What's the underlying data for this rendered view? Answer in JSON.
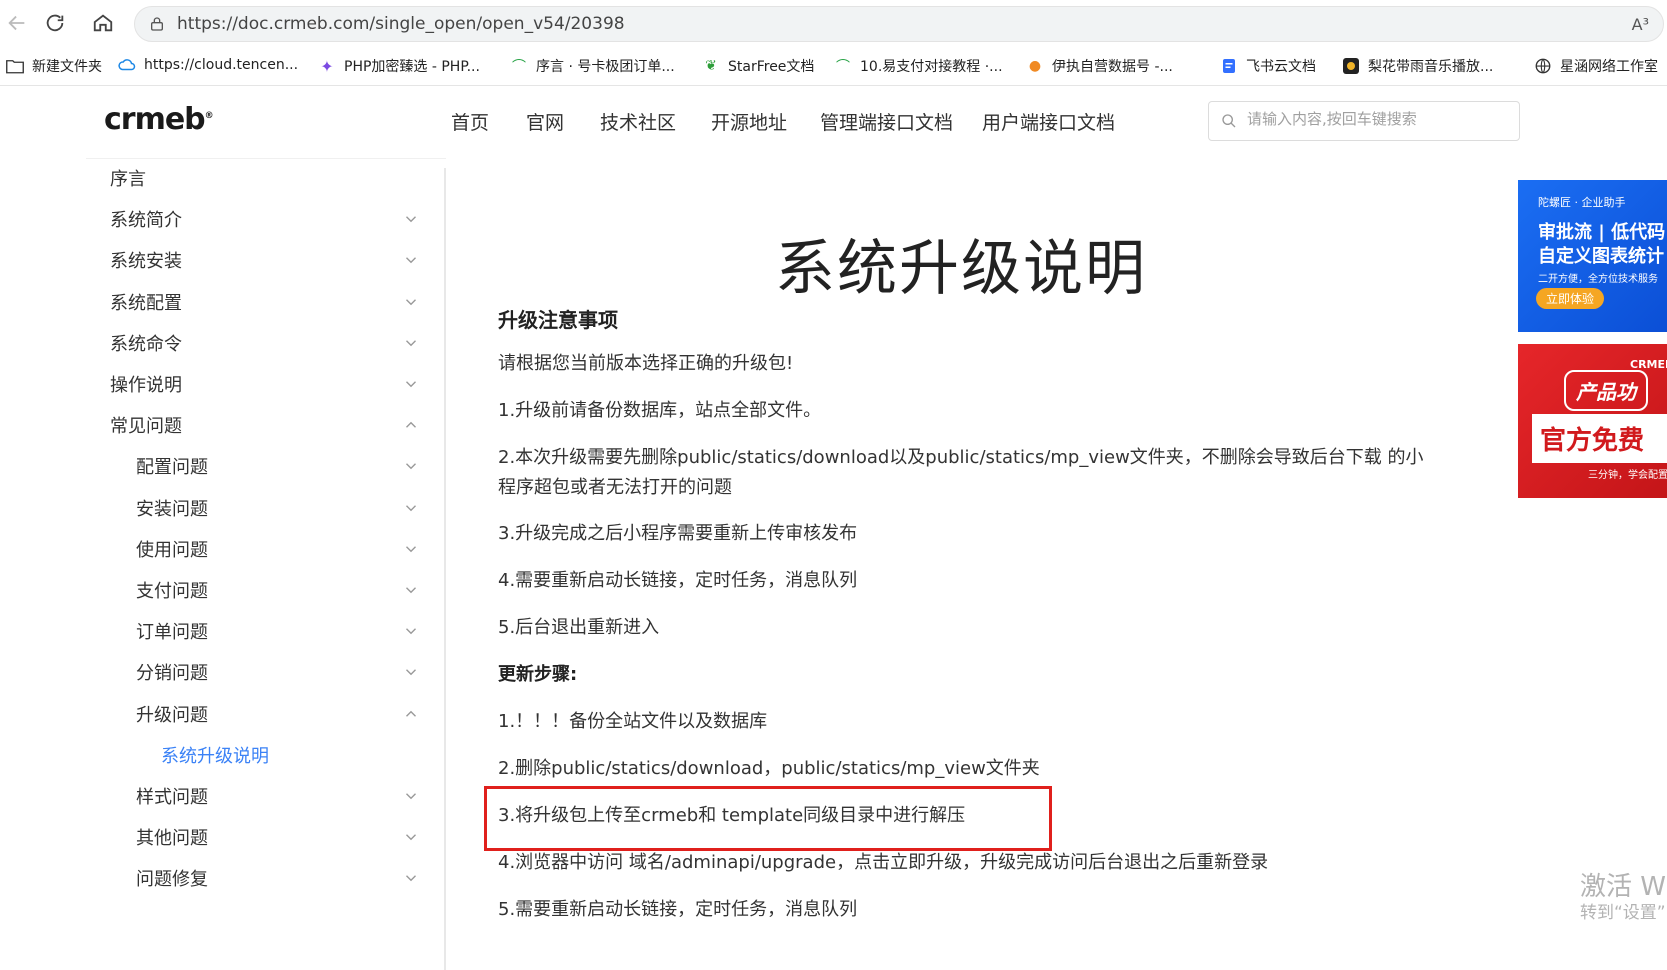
{
  "browser": {
    "url": "https://doc.crmeb.com/single_open/open_v54/20398",
    "read_aloud": "A³",
    "bookmarks": [
      {
        "label": "新建文件夹",
        "icon": "folder-icon"
      },
      {
        "label": "https://cloud.tencen...",
        "icon": "cloud-icon"
      },
      {
        "label": "PHP加密臻选 - PHP...",
        "icon": "star-icon"
      },
      {
        "label": "序言 · 号卡极团订单...",
        "icon": "link-icon"
      },
      {
        "label": "StarFree文档",
        "icon": "leaf-icon"
      },
      {
        "label": "10.易支付对接教程 ·...",
        "icon": "link-icon"
      },
      {
        "label": "伊执自营数据号 -...",
        "icon": "flame-icon"
      },
      {
        "label": "飞书云文档",
        "icon": "doc-icon"
      },
      {
        "label": "梨花带雨音乐播放...",
        "icon": "music-icon"
      },
      {
        "label": "星涵网络工作室",
        "icon": "globe-icon"
      }
    ]
  },
  "site": {
    "logo": "crmeb",
    "logo_mark": "®",
    "nav": [
      "首页",
      "官网",
      "技术社区",
      "开源地址",
      "管理端接口文档",
      "用户端接口文档"
    ],
    "search_placeholder": "请输入内容,按回车键搜索"
  },
  "sidebar": {
    "items": [
      {
        "label": "序言",
        "level": 0,
        "chevron": "none"
      },
      {
        "label": "系统简介",
        "level": 0,
        "chevron": "down"
      },
      {
        "label": "系统安装",
        "level": 0,
        "chevron": "down"
      },
      {
        "label": "系统配置",
        "level": 0,
        "chevron": "down"
      },
      {
        "label": "系统命令",
        "level": 0,
        "chevron": "down"
      },
      {
        "label": "操作说明",
        "level": 0,
        "chevron": "down"
      },
      {
        "label": "常见问题",
        "level": 0,
        "chevron": "up"
      },
      {
        "label": "配置问题",
        "level": 1,
        "chevron": "down"
      },
      {
        "label": "安装问题",
        "level": 1,
        "chevron": "down"
      },
      {
        "label": "使用问题",
        "level": 1,
        "chevron": "down"
      },
      {
        "label": "支付问题",
        "level": 1,
        "chevron": "down"
      },
      {
        "label": "订单问题",
        "level": 1,
        "chevron": "down"
      },
      {
        "label": "分销问题",
        "level": 1,
        "chevron": "down"
      },
      {
        "label": "升级问题",
        "level": 1,
        "chevron": "up"
      },
      {
        "label": "系统升级说明",
        "level": 2,
        "chevron": "none"
      },
      {
        "label": "样式问题",
        "level": 1,
        "chevron": "down"
      },
      {
        "label": "其他问题",
        "level": 1,
        "chevron": "down"
      },
      {
        "label": "问题修复",
        "level": 1,
        "chevron": "down"
      }
    ]
  },
  "article": {
    "title": "系统升级说明",
    "notice_title": "升级注意事项",
    "notice_lines": [
      "请根据您当前版本选择正确的升级包!",
      "1.升级前请备份数据库，站点全部文件。",
      "2.本次升级需要先删除public/statics/download以及public/statics/mp_view文件夹，不删除会导致后台下载 的小程序超包或者无法打开的问题",
      "3.升级完成之后小程序需要重新上传审核发布",
      "4.需要重新启动长链接，定时任务，消息队列",
      "5.后台退出重新进入"
    ],
    "steps_title": "更新步骤:",
    "steps": [
      "1.！！！备份全站文件以及数据库",
      "2.删除public/statics/download，public/statics/mp_view文件夹",
      "3.将升级包上传至crmeb和 template同级目录中进行解压",
      "4.浏览器中访问 域名/adminapi/upgrade，点击立即升级，升级完成访问后台退出之后重新登录",
      "5.需要重新启动长链接，定时任务，消息队列"
    ]
  },
  "ads": {
    "ad1": {
      "brand": "陀螺匠 · 企业助手",
      "line1": "审批流 | 低代码",
      "line2": "自定义图表统计",
      "line3": "二开方便，全方位技术服务",
      "button": "立即体验",
      "accent": "#f5a623"
    },
    "ad2": {
      "line1": "CRMEB",
      "line2": "产品功",
      "line3": "官方免费",
      "line4": "三分钟，学会配置"
    }
  },
  "watermark": {
    "line1": "激活 W",
    "line2": "转到“设置”"
  },
  "colors": {
    "highlight": "#e0201c",
    "active_link": "#3b82f6"
  }
}
